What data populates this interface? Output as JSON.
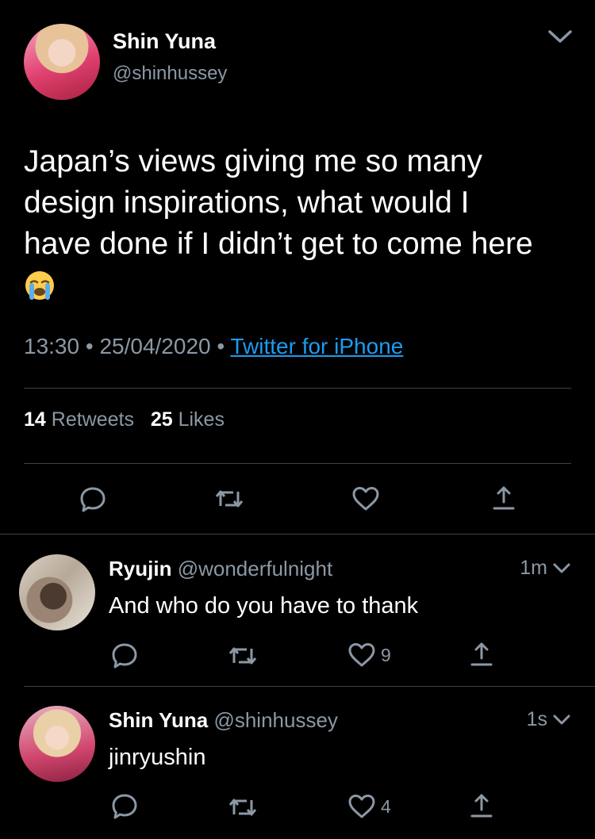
{
  "main_tweet": {
    "author_name": "Shin Yuna",
    "author_handle": "@shinhussey",
    "text_lines": [
      "Japan’s views giving me so many",
      "design inspirations, what would I",
      "have done if I didn’t get to come here"
    ],
    "emoji": "loudly-crying-face",
    "time": "13:30",
    "separator": "•",
    "date": "25/04/2020",
    "source": "Twitter for iPhone",
    "retweets_count": "14",
    "retweets_label": "Retweets",
    "likes_count": "25",
    "likes_label": "Likes"
  },
  "replies": [
    {
      "author_name": "Ryujin",
      "author_handle": "@wonderfulnight",
      "time": "1m",
      "text": "And who do you have to thank",
      "like_count": "9"
    },
    {
      "author_name": "Shin Yuna",
      "author_handle": "@shinhussey",
      "time": "1s",
      "text": "jinryushin",
      "like_count": "4"
    }
  ],
  "icons": {
    "menu": "chevron-down-icon",
    "reply": "reply-icon",
    "retweet": "retweet-icon",
    "like": "heart-icon",
    "share": "share-icon"
  },
  "colors": {
    "background": "#000000",
    "text": "#ffffff",
    "secondary": "#8b98a5",
    "link": "#1d9bf0",
    "divider": "#38444d"
  }
}
